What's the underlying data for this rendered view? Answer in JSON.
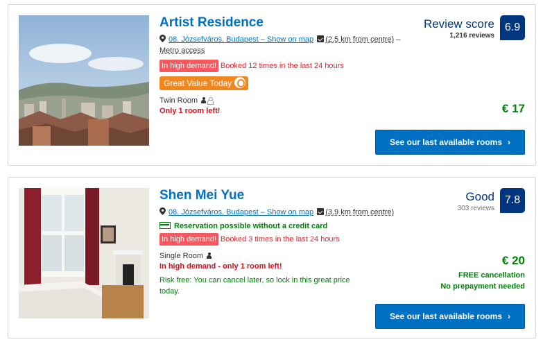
{
  "listings": [
    {
      "name": "Artist Residence",
      "location": "08. Józsefváros, Budapest – Show on map",
      "distance": "(2.5 km from centre)",
      "dash": "–",
      "metro": "Metro access",
      "demand_badge": "In high demand!",
      "demand_text": "Booked 12 times in the last 24 hours",
      "value_badge": "Great Value Today",
      "room_type": "Twin Room",
      "availability": "Only 1 room left!",
      "score_word": "Review score",
      "score_reviews": "1,216 reviews",
      "score": "6.9",
      "price": "€ 17",
      "cta": "See our last available rooms"
    },
    {
      "name": "Shen Mei Yue",
      "location": "08. Józsefváros, Budapest – Show on map",
      "distance": "(3.9 km from centre)",
      "no_credit_card": "Reservation possible without a credit card",
      "demand_badge": "In high demand!",
      "demand_text": "Booked 3 times in the last 24 hours",
      "room_type": "Single Room",
      "availability": "In high demand - only 1 room left!",
      "risk_free": "Risk free: You can cancel later, so lock in this great price today.",
      "score_word": "Good",
      "score_reviews": "303 reviews",
      "score": "7.8",
      "price": "€ 20",
      "free_cancellation": "FREE cancellation",
      "no_prepayment": "No prepayment needed",
      "cta": "See our last available rooms"
    }
  ],
  "icons": {
    "chevron": "›"
  },
  "colors": {
    "link_blue": "#0071c2",
    "score_navy": "#003580",
    "price_green": "#008009",
    "demand_red": "#f5585e",
    "value_orange": "#f0861e"
  }
}
